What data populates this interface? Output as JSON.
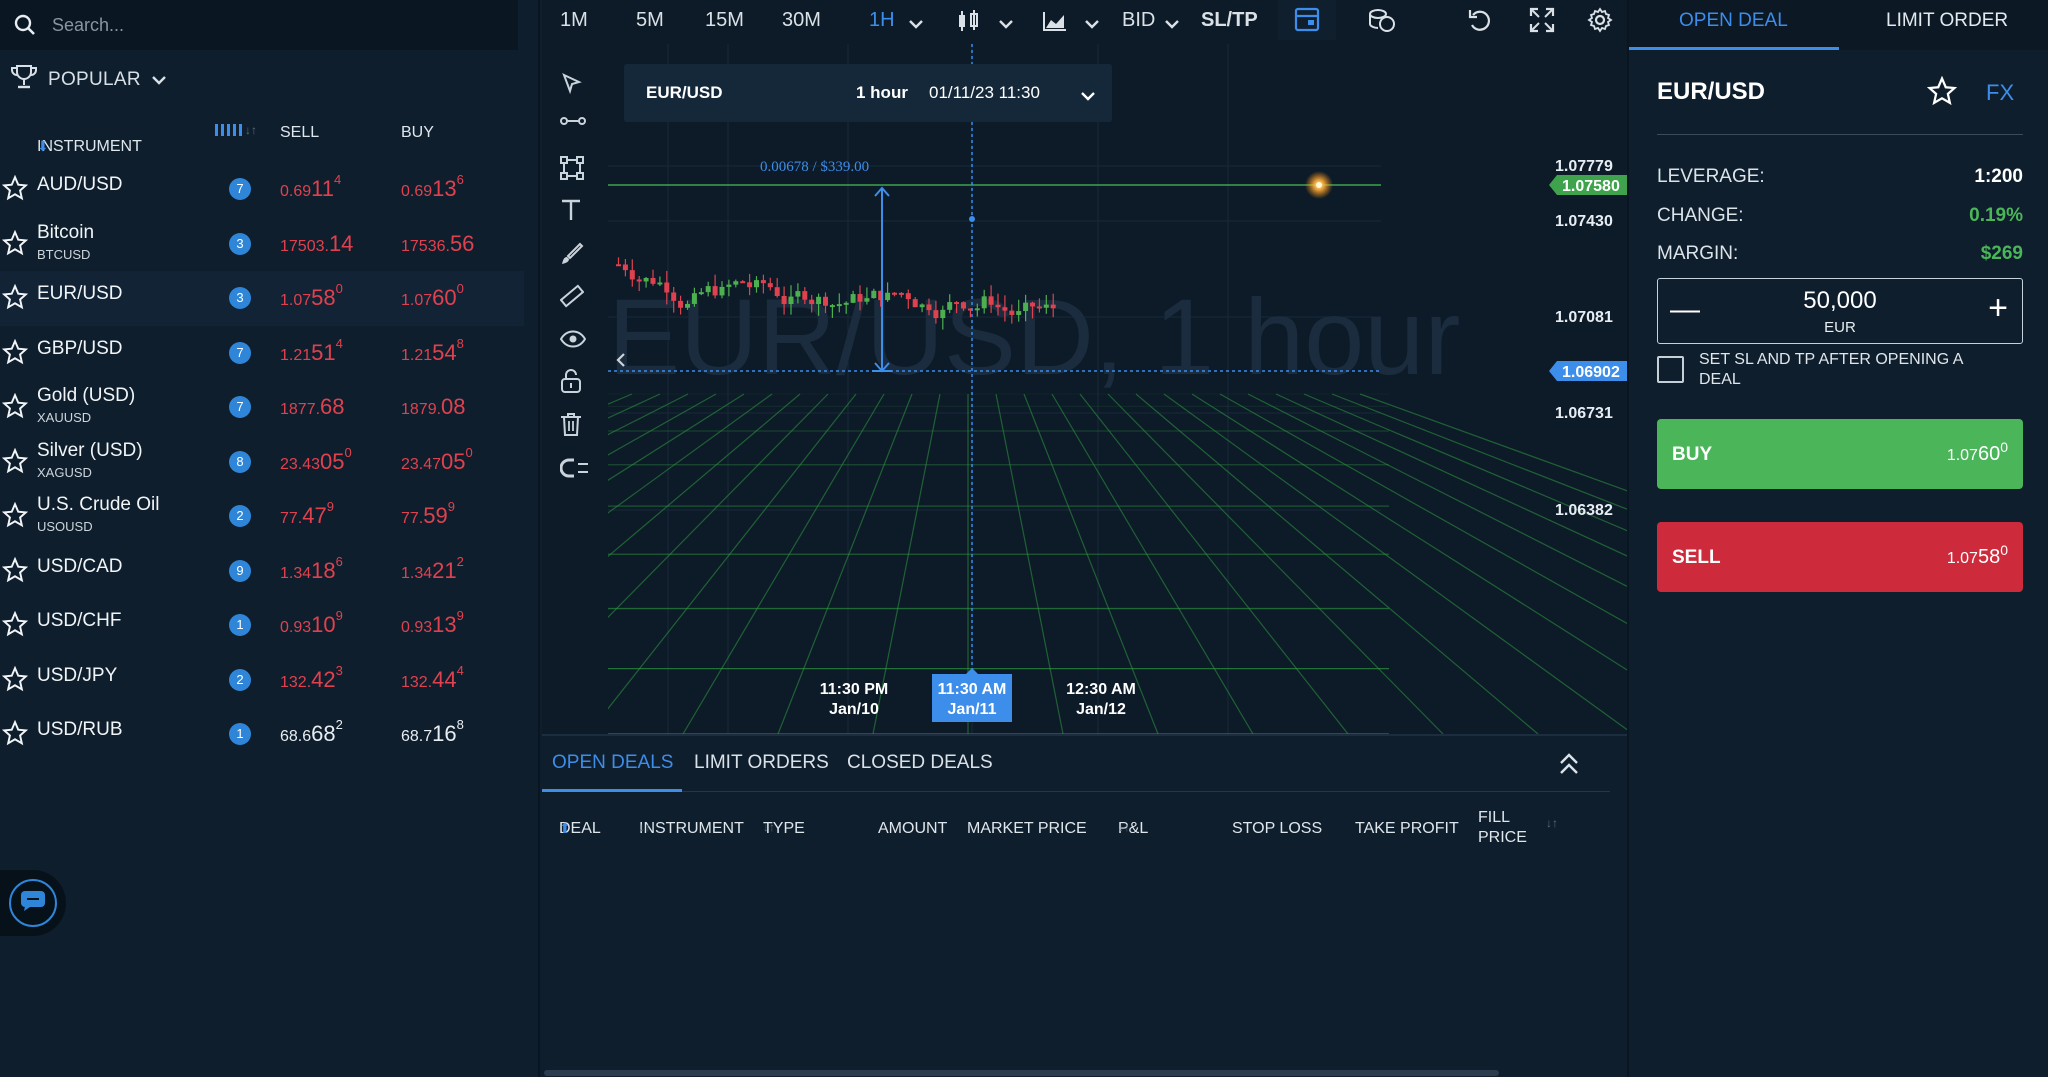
{
  "search": {
    "placeholder": "Search..."
  },
  "popular": {
    "label": "POPULAR"
  },
  "table_headers": {
    "instrument": "INSTRUMENT",
    "sell": "SELL",
    "buy": "BUY"
  },
  "instruments": [
    {
      "name": "AUD/USD",
      "sub": "",
      "badge": "7",
      "sell_a": "0.69",
      "sell_b": "11",
      "sell_c": "4",
      "buy_a": "0.69",
      "buy_b": "13",
      "buy_c": "6"
    },
    {
      "name": "Bitcoin",
      "sub": "BTCUSD",
      "badge": "3",
      "sell_a": "17503.",
      "sell_b": "14",
      "sell_c": "",
      "buy_a": "17536.",
      "buy_b": "56",
      "buy_c": ""
    },
    {
      "name": "EUR/USD",
      "sub": "",
      "badge": "3",
      "sell_a": "1.07",
      "sell_b": "58",
      "sell_c": "0",
      "buy_a": "1.07",
      "buy_b": "60",
      "buy_c": "0"
    },
    {
      "name": "GBP/USD",
      "sub": "",
      "badge": "7",
      "sell_a": "1.21",
      "sell_b": "51",
      "sell_c": "4",
      "buy_a": "1.21",
      "buy_b": "54",
      "buy_c": "8"
    },
    {
      "name": "Gold (USD)",
      "sub": "XAUUSD",
      "badge": "7",
      "sell_a": "1877.",
      "sell_b": "68",
      "sell_c": "",
      "buy_a": "1879.",
      "buy_b": "08",
      "buy_c": ""
    },
    {
      "name": "Silver (USD)",
      "sub": "XAGUSD",
      "badge": "8",
      "sell_a": "23.43",
      "sell_b": "05",
      "sell_c": "0",
      "buy_a": "23.47",
      "buy_b": "05",
      "buy_c": "0"
    },
    {
      "name": "U.S. Crude Oil",
      "sub": "USOUSD",
      "badge": "2",
      "sell_a": "77.",
      "sell_b": "47",
      "sell_c": "9",
      "buy_a": "77.",
      "buy_b": "59",
      "buy_c": "9"
    },
    {
      "name": "USD/CAD",
      "sub": "",
      "badge": "9",
      "sell_a": "1.34",
      "sell_b": "18",
      "sell_c": "6",
      "buy_a": "1.34",
      "buy_b": "21",
      "buy_c": "2"
    },
    {
      "name": "USD/CHF",
      "sub": "",
      "badge": "1",
      "sell_a": "0.93",
      "sell_b": "10",
      "sell_c": "9",
      "buy_a": "0.93",
      "buy_b": "13",
      "buy_c": "9"
    },
    {
      "name": "USD/JPY",
      "sub": "",
      "badge": "2",
      "sell_a": "132.",
      "sell_b": "42",
      "sell_c": "3",
      "buy_a": "132.",
      "buy_b": "44",
      "buy_c": "4"
    },
    {
      "name": "USD/RUB",
      "sub": "",
      "badge": "1",
      "sell_a": "68.6",
      "sell_b": "68",
      "sell_c": "2",
      "buy_a": "68.7",
      "buy_b": "16",
      "buy_c": "8",
      "white": true
    }
  ],
  "toolbar": {
    "t1": "1M",
    "t2": "5M",
    "t3": "15M",
    "t4": "30M",
    "t5": "1H",
    "bid": "BID",
    "sltp": "SL/TP"
  },
  "chart": {
    "symbol": "EUR/USD",
    "interval": "1 hour",
    "datetime": "01/11/23 11:30",
    "watermark": "EUR/USD, 1 hour",
    "measure": "0.00678 / $339.00",
    "price_ticks": [
      "1.07779",
      "1.07430",
      "1.07081",
      "1.06731",
      "1.06382"
    ],
    "current_price": "1.07580",
    "cursor_price": "1.06902",
    "time_labels": [
      {
        "t": "11:30 PM",
        "d": "Jan/10"
      },
      {
        "t": "11:30 AM",
        "d": "Jan/11"
      },
      {
        "t": "12:30 AM",
        "d": "Jan/12"
      }
    ],
    "up_color": "#4caf50",
    "down_color": "#e0414f",
    "accent": "#3d8dea"
  },
  "chart_data": {
    "type": "candlestick",
    "x_labels": [
      "11:30 PM Jan/10",
      "11:30 AM Jan/11",
      "12:30 AM Jan/12"
    ],
    "y_ticks": [
      1.07779,
      1.0743,
      1.07081,
      1.06731,
      1.06382
    ],
    "current_price": 1.0758
  },
  "bottom": {
    "tabs": [
      "OPEN DEALS",
      "LIMIT ORDERS",
      "CLOSED DEALS"
    ],
    "cols": {
      "deal": "DEAL",
      "instrument": "INSTRUMENT",
      "type": "TYPE",
      "amount": "AMOUNT",
      "market_price": "MARKET PRICE",
      "pl": "P&L",
      "stop_loss": "STOP LOSS",
      "take_profit": "TAKE PROFIT",
      "fill1": "FILL",
      "fill2": "PRICE"
    }
  },
  "right": {
    "tab_open": "OPEN DEAL",
    "tab_limit": "LIMIT ORDER",
    "symbol": "EUR/USD",
    "fx": "FX",
    "leverage_k": "LEVERAGE:",
    "leverage_v": "1:200",
    "change_k": "CHANGE:",
    "change_v": "0.19%",
    "margin_k": "MARGIN:",
    "margin_v": "$269",
    "amount": "50,000",
    "currency": "EUR",
    "sltp_text": "SET SL AND TP AFTER OPENING A DEAL",
    "buy_label": "BUY",
    "buy_a": "1.07",
    "buy_b": "60",
    "buy_c": "0",
    "sell_label": "SELL",
    "sell_a": "1.07",
    "sell_b": "58",
    "sell_c": "0"
  }
}
